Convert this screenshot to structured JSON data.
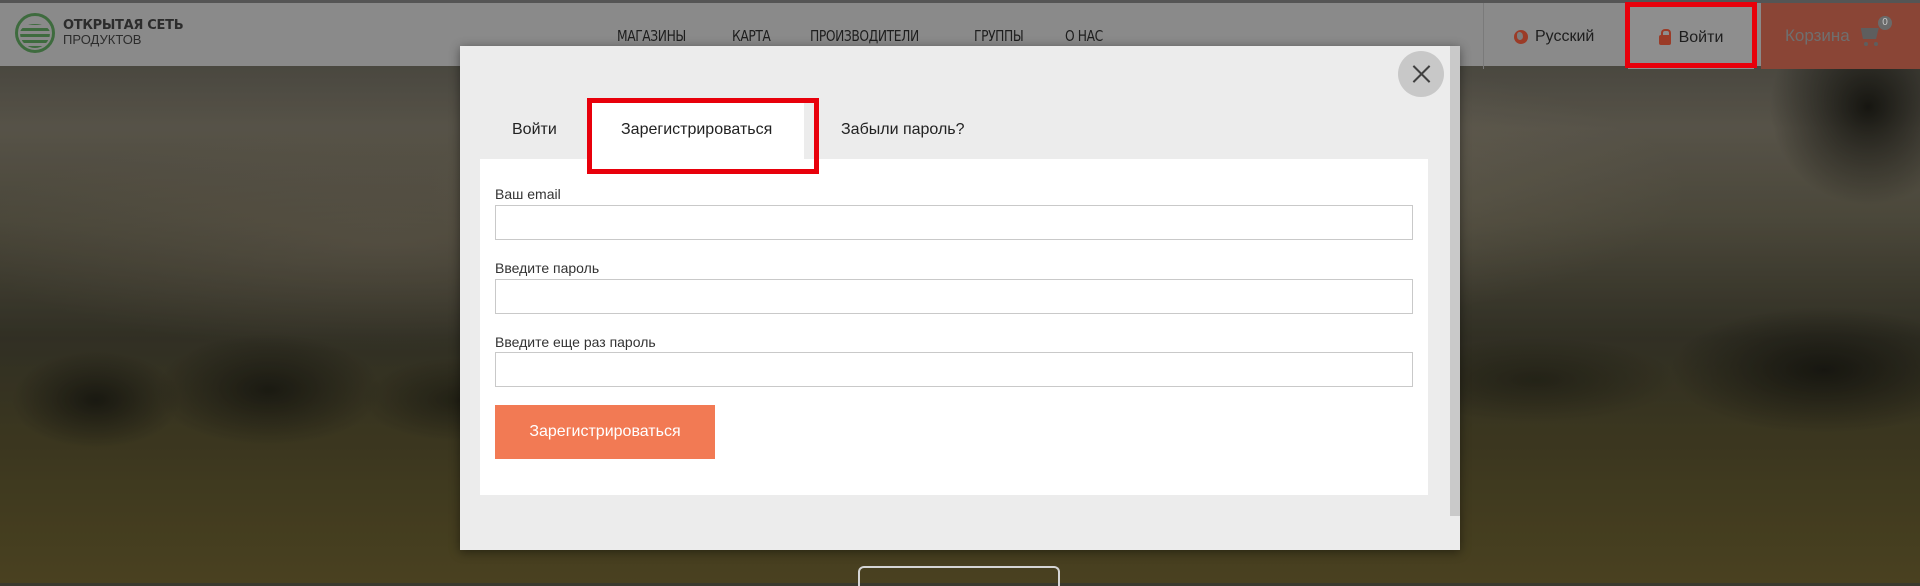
{
  "header": {
    "logo_title": "ОТКРЫТАЯ СЕТЬ",
    "logo_sub": "ПРОДУКТОВ",
    "nav": [
      "МАГАЗИНЫ",
      "КАРТА",
      "ПРОИЗВОДИТЕЛИ",
      "ГРУППЫ",
      "О НАС"
    ],
    "language": "Русский",
    "login": "Войти",
    "cart": "Корзина",
    "cart_count": "0"
  },
  "modal": {
    "tabs": [
      "Войти",
      "Зарегистрироваться",
      "Забыли пароль?"
    ],
    "active_tab": "Зарегистрироваться",
    "fields": [
      {
        "label": "Ваш email",
        "value": ""
      },
      {
        "label": "Введите пароль",
        "value": ""
      },
      {
        "label": "Введите еще раз пароль",
        "value": ""
      }
    ],
    "submit_label": "Зарегистрироваться"
  },
  "colors": {
    "accent": "#f27a54",
    "highlight": "#e8000b",
    "cart_bg": "#8a4536"
  }
}
